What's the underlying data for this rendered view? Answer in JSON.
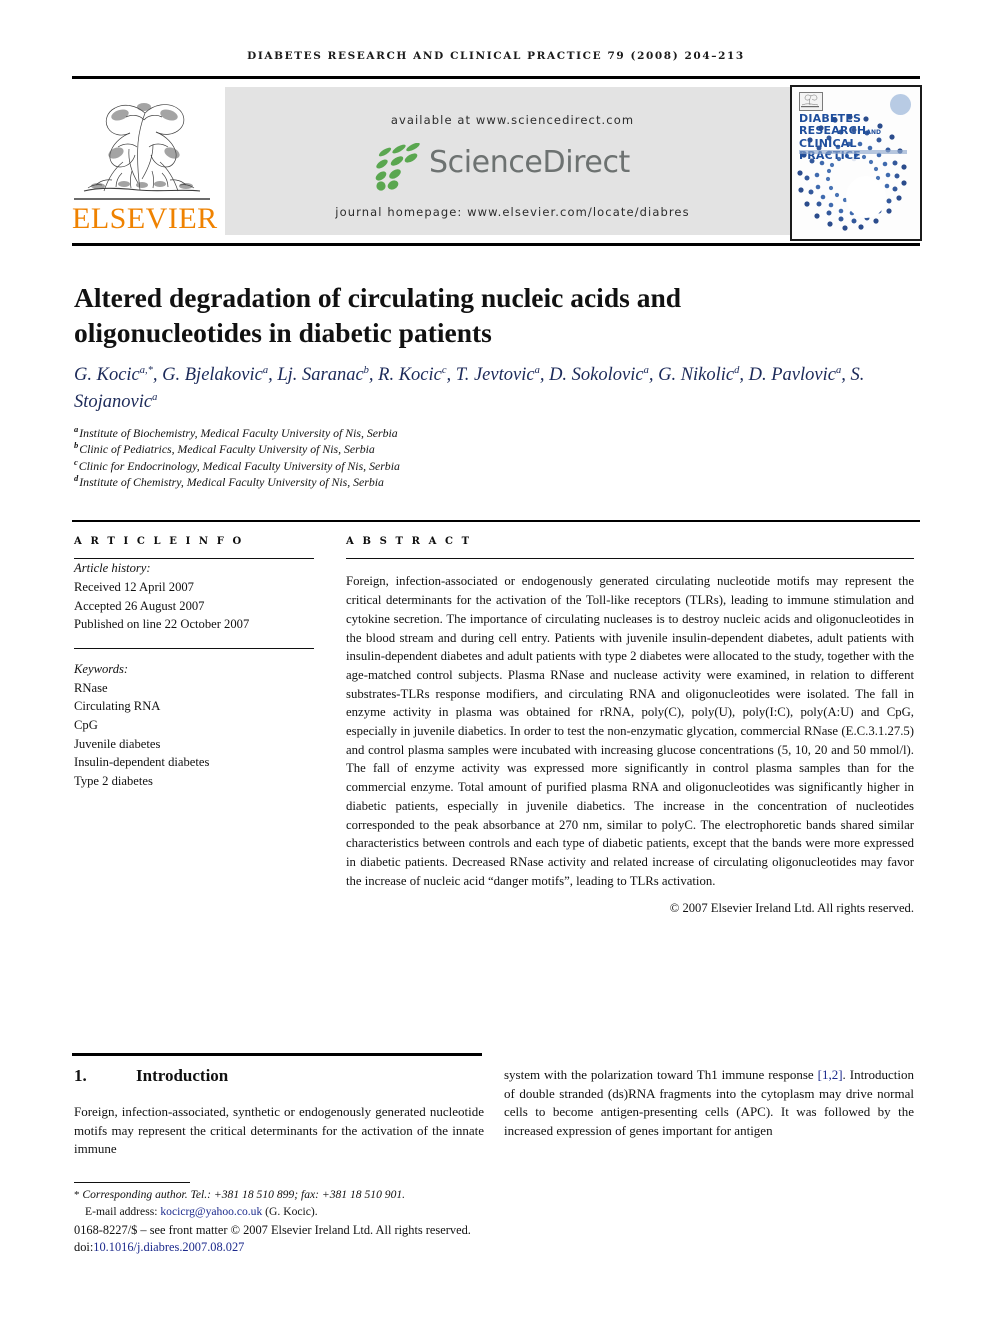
{
  "running_head": "DIABETES RESEARCH AND CLINICAL PRACTICE 79 (2008) 204–213",
  "masthead": {
    "elsevier_wordmark": "ELSEVIER",
    "available_at": "available at www.sciencedirect.com",
    "journal_homepage": "journal homepage: www.elsevier.com/locate/diabres",
    "sciencedirect_logo_text": "ScienceDirect",
    "cover": {
      "line1": "DIABETES",
      "line2": "RESEARCH",
      "line2_small": "AND",
      "line3": "CLINICAL PRACTICE"
    },
    "colors": {
      "elsevier_orange": "#ef8200",
      "banner_gray": "#e3e3e3",
      "sciencedirect_green": "#5aa750",
      "sciencedirect_gray": "#6d7271",
      "cover_blue": "#1f4e9c"
    }
  },
  "title": "Altered degradation of circulating nucleic acids and oligonucleotides in diabetic patients",
  "authors": [
    {
      "name": "G. Kocic",
      "sup": "a,*"
    },
    {
      "name": "G. Bjelakovic",
      "sup": "a"
    },
    {
      "name": "Lj. Saranac",
      "sup": "b"
    },
    {
      "name": "R. Kocic",
      "sup": "c"
    },
    {
      "name": "T. Jevtovic",
      "sup": "a"
    },
    {
      "name": "D. Sokolovic",
      "sup": "a"
    },
    {
      "name": "G. Nikolic",
      "sup": "d"
    },
    {
      "name": "D. Pavlovic",
      "sup": "a"
    },
    {
      "name": "S. Stojanovic",
      "sup": "a"
    }
  ],
  "affiliations": [
    {
      "marker": "a",
      "text": "Institute of Biochemistry, Medical Faculty University of Nis, Serbia"
    },
    {
      "marker": "b",
      "text": "Clinic of Pediatrics, Medical Faculty University of Nis, Serbia"
    },
    {
      "marker": "c",
      "text": "Clinic for Endocrinology, Medical Faculty University of Nis, Serbia"
    },
    {
      "marker": "d",
      "text": "Institute of Chemistry, Medical Faculty University of Nis, Serbia"
    }
  ],
  "article_info": {
    "label": "A R T I C L E   I N F O",
    "history_head": "Article history:",
    "history": [
      "Received 12 April 2007",
      "Accepted 26 August 2007",
      "Published on line 22 October 2007"
    ],
    "keywords_head": "Keywords:",
    "keywords": [
      "RNase",
      "Circulating RNA",
      "CpG",
      "Juvenile diabetes",
      "Insulin-dependent diabetes",
      "Type 2 diabetes"
    ]
  },
  "abstract": {
    "label": "A B S T R A C T",
    "text": "Foreign, infection-associated or endogenously generated circulating nucleotide motifs may represent the critical determinants for the activation of the Toll-like receptors (TLRs), leading to immune stimulation and cytokine secretion. The importance of circulating nucleases is to destroy nucleic acids and oligonucleotides in the blood stream and during cell entry. Patients with juvenile insulin-dependent diabetes, adult patients with insulin-dependent diabetes and adult patients with type 2 diabetes were allocated to the study, together with the age-matched control subjects. Plasma RNase and nuclease activity were examined, in relation to different substrates-TLRs response modifiers, and circulating RNA and oligonucleotides were isolated. The fall in enzyme activity in plasma was obtained for rRNA, poly(C), poly(U), poly(I:C), poly(A:U) and CpG, especially in juvenile diabetics. In order to test the non-enzymatic glycation, commercial RNase (E.C.3.1.27.5) and control plasma samples were incubated with increasing glucose concentrations (5, 10, 20 and 50 mmol/l). The fall of enzyme activity was expressed more significantly in control plasma samples than for the commercial enzyme. Total amount of purified plasma RNA and oligonucleotides was significantly higher in diabetic patients, especially in juvenile diabetics. The increase in the concentration of nucleotides corresponded to the peak absorbance at 270 nm, similar to polyC. The electrophoretic bands shared similar characteristics between controls and each type of diabetic patients, except that the bands were more expressed in diabetic patients. Decreased RNase activity and related increase of circulating oligonucleotides may favor the increase of nucleic acid “danger motifs”, leading to TLRs activation.",
    "copyright": "© 2007 Elsevier Ireland Ltd. All rights reserved."
  },
  "introduction": {
    "number": "1.",
    "heading": "Introduction",
    "left_text": "Foreign, infection-associated, synthetic or endogenously generated nucleotide motifs may represent the critical determinants for the activation of the innate immune",
    "right_text_before_cite": "system with the polarization toward Th1 immune response ",
    "citation": "[1,2]",
    "right_text_after_cite": ". Introduction of double stranded (ds)RNA fragments into the cytoplasm may drive normal cells to become antigen-presenting cells (APC). It was followed by the increased expression of genes important for antigen"
  },
  "footnote": {
    "star": "*",
    "corresponding": "Corresponding author. Tel.: +381 18 510 899; fax: +381 18 510 901.",
    "email_label": "E-mail address:",
    "email": "kocicrg@yahoo.co.uk",
    "email_attrib": "(G. Kocic)."
  },
  "imprint": {
    "issn_line": "0168-8227/$ – see front matter © 2007 Elsevier Ireland Ltd. All rights reserved.",
    "doi_prefix": "doi:",
    "doi": "10.1016/j.diabres.2007.08.027"
  }
}
